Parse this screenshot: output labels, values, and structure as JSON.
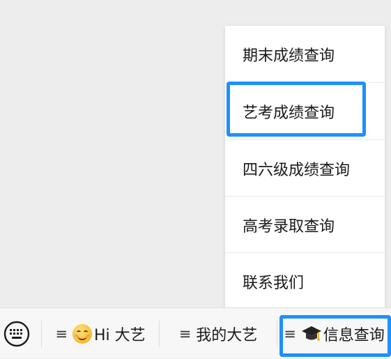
{
  "popup_menu": {
    "items": [
      {
        "label": "期末成绩查询"
      },
      {
        "label": "艺考成绩查询"
      },
      {
        "label": "四六级成绩查询"
      },
      {
        "label": "高考录取查询"
      },
      {
        "label": "联系我们"
      }
    ]
  },
  "bottom_bar": {
    "menu_glyph": "≡",
    "menus": [
      {
        "label": "Hi 大艺",
        "icon": "smiling-face-icon"
      },
      {
        "label": "我的大艺"
      },
      {
        "label": "信息查询",
        "icon": "graduation-cap-icon"
      }
    ]
  },
  "colors": {
    "highlight": "#1e90ff",
    "background": "#ededed",
    "menu_background": "#ffffff",
    "bar_background": "#f7f7f7"
  }
}
